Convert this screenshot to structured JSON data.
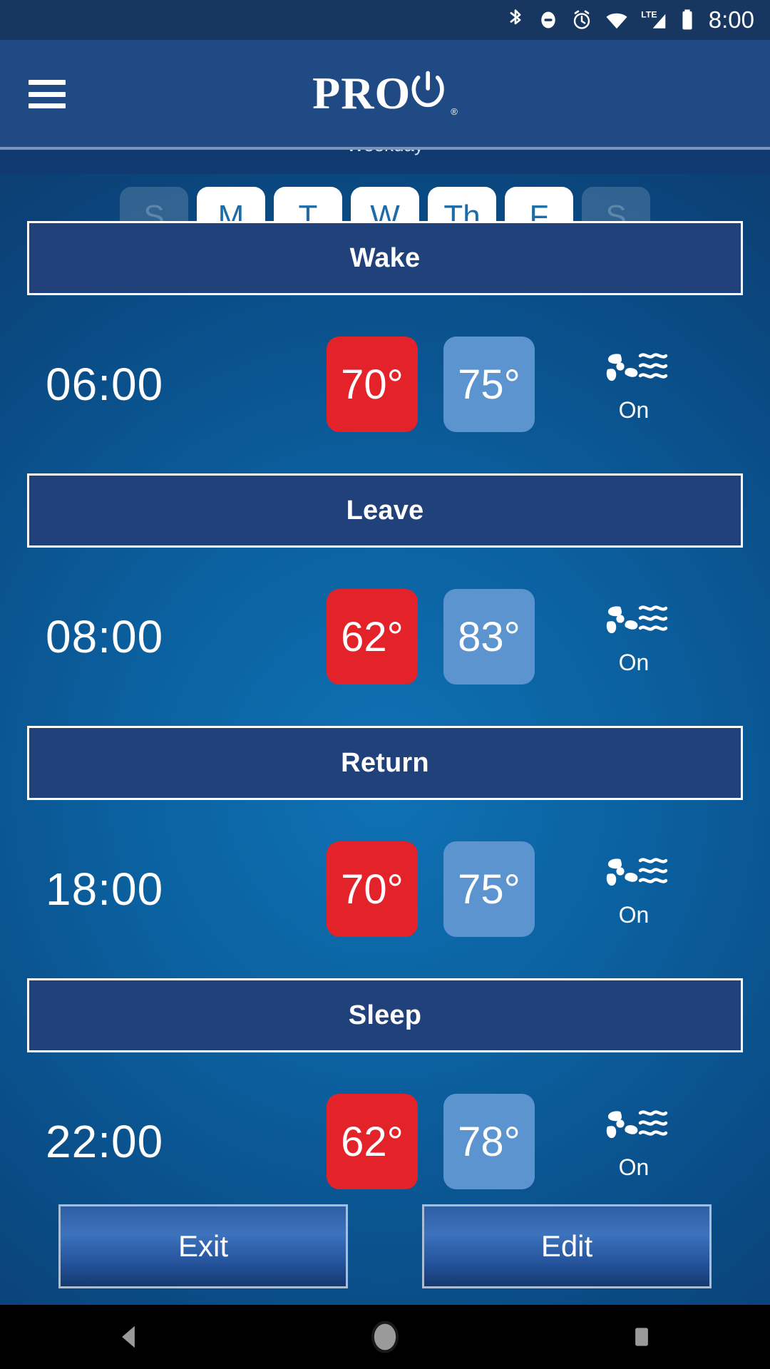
{
  "status_bar": {
    "time": "8:00",
    "icons": [
      "bluetooth-icon",
      "do-not-disturb-icon",
      "alarm-icon",
      "wifi-icon",
      "lte-signal-icon",
      "battery-icon"
    ],
    "background_color": "#173761"
  },
  "app_bar": {
    "menu_icon": "hamburger-menu-icon",
    "brand": "PRO",
    "brand_registered_mark": "®",
    "background_color": "#1f4a83"
  },
  "clipped_header_text": "Weekday",
  "day_selector": {
    "days": [
      {
        "label": "S",
        "selected": false
      },
      {
        "label": "M",
        "selected": true
      },
      {
        "label": "T",
        "selected": true
      },
      {
        "label": "W",
        "selected": true
      },
      {
        "label": "Th",
        "selected": true
      },
      {
        "label": "F",
        "selected": true
      },
      {
        "label": "S",
        "selected": false
      }
    ],
    "selected_bg": "#ffffff",
    "selected_fg": "#1b6ca8"
  },
  "schedule": {
    "periods": [
      {
        "name": "Wake",
        "time": "06:00",
        "heat_temp": "70°",
        "cool_temp": "75°",
        "fan_icon": "fan-blowing-icon",
        "fan_state": "On"
      },
      {
        "name": "Leave",
        "time": "08:00",
        "heat_temp": "62°",
        "cool_temp": "83°",
        "fan_icon": "fan-blowing-icon",
        "fan_state": "On"
      },
      {
        "name": "Return",
        "time": "18:00",
        "heat_temp": "70°",
        "cool_temp": "75°",
        "fan_icon": "fan-blowing-icon",
        "fan_state": "On"
      },
      {
        "name": "Sleep",
        "time": "22:00",
        "heat_temp": "62°",
        "cool_temp": "78°",
        "fan_icon": "fan-blowing-icon",
        "fan_state": "On"
      }
    ],
    "heat_color": "#e42229",
    "cool_color": "#5b94cf",
    "band_color": "#20417a"
  },
  "footer": {
    "exit_label": "Exit",
    "edit_label": "Edit"
  },
  "nav_bar": {
    "back_icon": "back-triangle-icon",
    "home_icon": "home-circle-icon",
    "recents_icon": "recents-square-icon"
  }
}
